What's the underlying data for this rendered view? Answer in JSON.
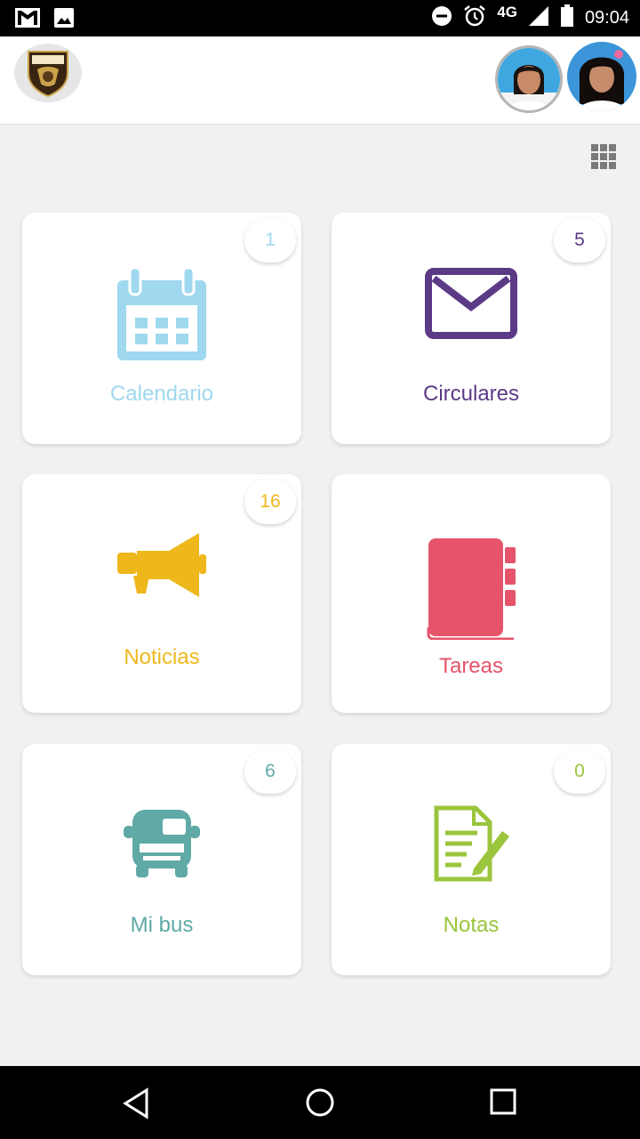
{
  "status_bar": {
    "time": "09:04",
    "network": "4G",
    "icons": [
      "gmail-icon",
      "image-icon",
      "do-not-disturb-icon",
      "alarm-icon",
      "signal-icon",
      "battery-icon"
    ]
  },
  "header": {
    "logo_icon": "school-crest-icon",
    "avatars": [
      "student-avatar-1",
      "student-avatar-2"
    ]
  },
  "toolbar": {
    "grid_icon": "apps-grid-icon"
  },
  "cards": [
    {
      "label": "Calendario",
      "badge": "1",
      "color": "#9fd8ef",
      "icon": "calendar-icon"
    },
    {
      "label": "Circulares",
      "badge": "5",
      "color": "#5b3a86",
      "icon": "envelope-icon"
    },
    {
      "label": "Noticias",
      "badge": "16",
      "color": "#eeb81c",
      "icon": "megaphone-icon"
    },
    {
      "label": "Tareas",
      "badge": "",
      "color": "#e5546a",
      "icon": "notebook-icon"
    },
    {
      "label": "Mi bus",
      "badge": "6",
      "color": "#5fa9a6",
      "icon": "bus-icon"
    },
    {
      "label": "Notas",
      "badge": "0",
      "color": "#9bc53d",
      "icon": "document-edit-icon"
    }
  ],
  "navigation": {
    "icons": [
      "back-icon",
      "home-icon",
      "recents-icon"
    ]
  }
}
